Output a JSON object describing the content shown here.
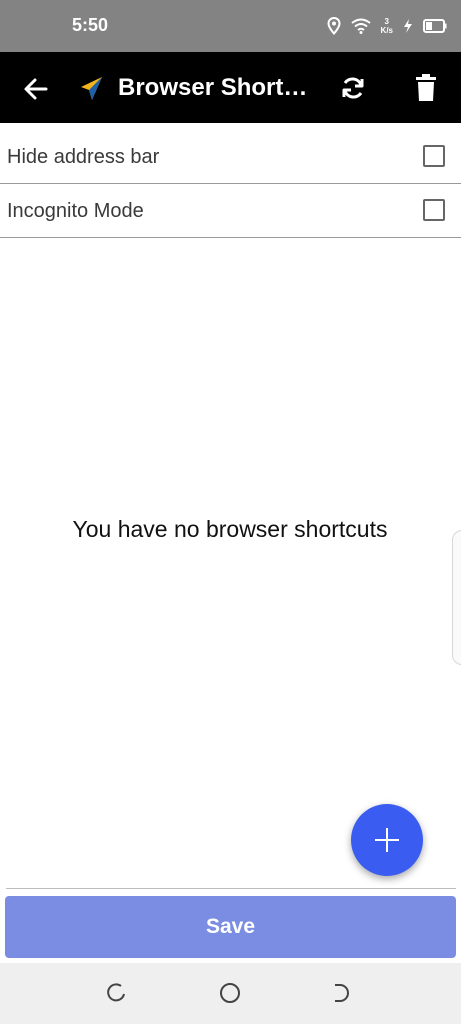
{
  "status_bar": {
    "time": "5:50",
    "speed_value": "3",
    "speed_unit": "K/s",
    "icons": [
      "location-icon",
      "wifi-icon",
      "charging-icon",
      "battery-icon"
    ]
  },
  "app_bar": {
    "title": "Browser Shortcuts",
    "icons": [
      "back-arrow-icon",
      "app-logo-icon",
      "refresh-icon",
      "trash-icon"
    ]
  },
  "options": {
    "hide_address_bar": {
      "label": "Hide address bar",
      "checked": false
    },
    "incognito_mode": {
      "label": "Incognito Mode",
      "checked": false
    }
  },
  "empty_state": {
    "message": "You have no browser shortcuts"
  },
  "fab": {
    "icon": "plus-icon",
    "color": "#3a5cf0"
  },
  "save_button": {
    "label": "Save",
    "color": "#7b8de2"
  },
  "nav_bar": {
    "icons": [
      "nav-back-icon",
      "nav-home-icon",
      "nav-recent-icon"
    ]
  },
  "colors": {
    "status_bar": "#838383",
    "app_bar": "#000000",
    "logo_yellow": "#f3b31c",
    "logo_blue": "#1f5fa8"
  }
}
